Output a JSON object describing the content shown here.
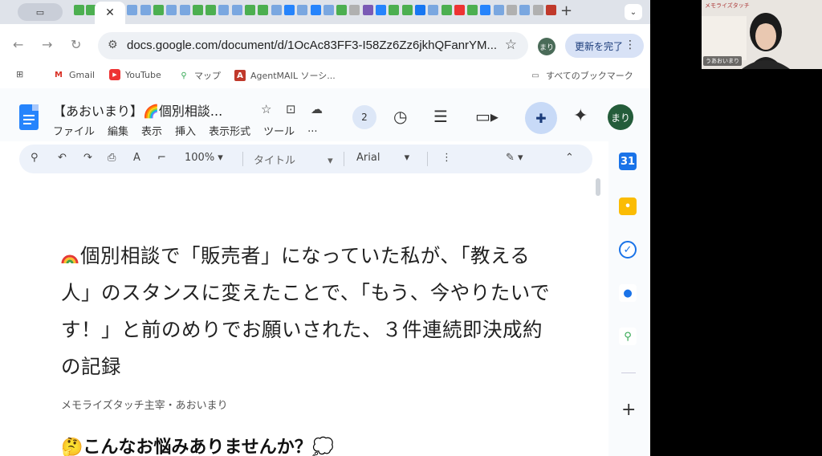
{
  "browser": {
    "address": {
      "url": "docs.google.com/document/d/1OcAc83FF3-I58Zz6Zz6jkhQFanrYM..."
    },
    "profile_initials": "まり",
    "update_button": "更新を完了"
  },
  "bookmarks": {
    "items": [
      {
        "label": "Gmail",
        "icon": "gmail-icon"
      },
      {
        "label": "YouTube",
        "icon": "youtube-icon"
      },
      {
        "label": "マップ",
        "icon": "maps-icon"
      },
      {
        "label": "AgentMAIL ソーシ...",
        "icon": "agentmail-icon"
      }
    ],
    "all_bookmarks": "すべてのブックマーク"
  },
  "docs": {
    "title": "【あおいまり】🌈個別相談...",
    "menus": [
      "ファイル",
      "編集",
      "表示",
      "挿入",
      "表示形式",
      "ツール",
      "..."
    ],
    "collaborators_count": "2",
    "user_initials": "まり"
  },
  "toolbar": {
    "zoom": "100%",
    "style": "タイトル",
    "font": "Arial"
  },
  "document": {
    "heading": "個別相談で「販売者」になっていた私が、「教える人」のスタンスに変えたことで、「もう、今やりたいです！」と前のめりでお願いされた、３件連続即決成約の記録",
    "author": "メモライズタッチ主宰・あおいまり",
    "subheading": "🤔こんなお悩みありませんか？💭"
  },
  "webcam": {
    "caption": "メモライズタッチ",
    "name_label": "うあおいまり"
  },
  "colors": {
    "docs_blue": "#2684fc",
    "avatar_green": "#245c3a",
    "toolbar_bg": "#edf2fa"
  }
}
